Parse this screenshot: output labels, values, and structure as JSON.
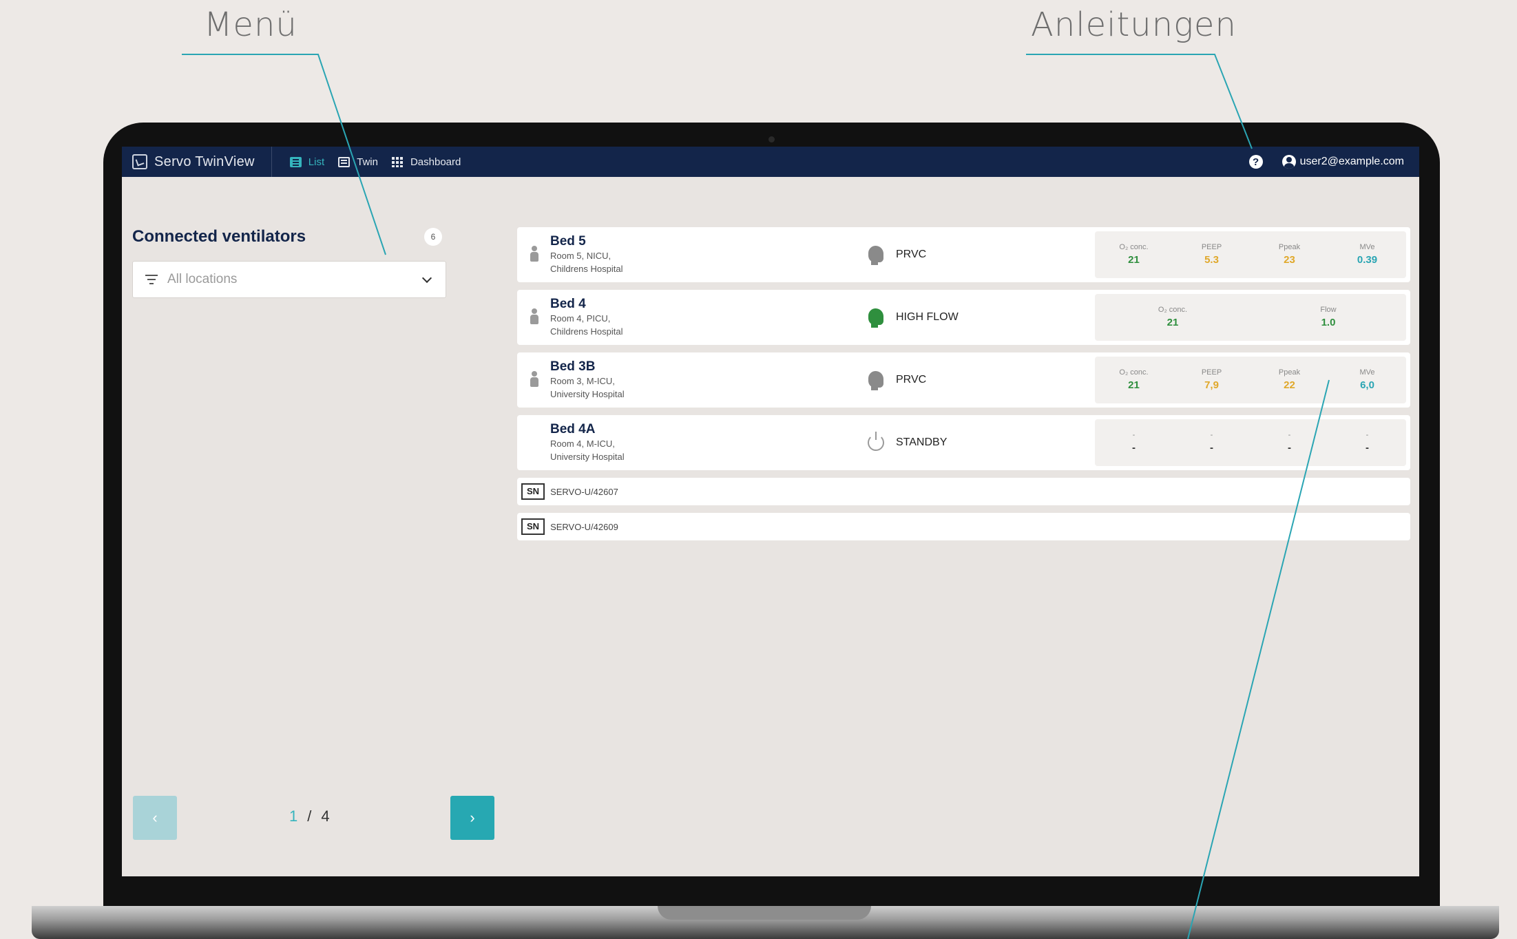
{
  "annotations": {
    "menu_label": "Menü",
    "guides_label": "Anleitungen"
  },
  "app": {
    "brand": "Servo TwinView",
    "nav": [
      {
        "label": "List",
        "active": true,
        "icon": "list-icon"
      },
      {
        "label": "Twin",
        "active": false,
        "icon": "twin-icon"
      },
      {
        "label": "Dashboard",
        "active": false,
        "icon": "dashboard-grid-icon"
      }
    ],
    "help_icon": "?",
    "user_email": "user2@example.com"
  },
  "sidebar": {
    "title": "Connected ventilators",
    "count": "6",
    "location_select": "All locations"
  },
  "pager": {
    "prev": "‹",
    "next": "›",
    "current": "1",
    "separator": "/",
    "total": "4"
  },
  "beds": [
    {
      "name": "Bed 5",
      "location_line1": "Room 5, NICU,",
      "location_line2": "Childrens Hospital",
      "mode": "PRVC",
      "mode_icon": "head-icon-gray",
      "params": [
        {
          "label": "O₂ conc.",
          "value": "21",
          "color": "green"
        },
        {
          "label": "PEEP",
          "value": "5.3",
          "color": "amber"
        },
        {
          "label": "Ppeak",
          "value": "23",
          "color": "amber"
        },
        {
          "label": "MVe",
          "value": "0.39",
          "color": "teal"
        }
      ]
    },
    {
      "name": "Bed 4",
      "location_line1": "Room 4, PICU,",
      "location_line2": "Childrens Hospital",
      "mode": "HIGH FLOW",
      "mode_icon": "head-icon-green",
      "params": [
        {
          "label": "O₂ conc.",
          "value": "21",
          "color": "green"
        },
        {
          "label": "Flow",
          "value": "1.0",
          "color": "green"
        }
      ]
    },
    {
      "name": "Bed 3B",
      "location_line1": "Room 3, M-ICU,",
      "location_line2": "University Hospital",
      "mode": "PRVC",
      "mode_icon": "head-icon-gray",
      "params": [
        {
          "label": "O₂ conc.",
          "value": "21",
          "color": "green"
        },
        {
          "label": "PEEP",
          "value": "7,9",
          "color": "amber"
        },
        {
          "label": "Ppeak",
          "value": "22",
          "color": "amber"
        },
        {
          "label": "MVe",
          "value": "6,0",
          "color": "teal"
        }
      ]
    },
    {
      "name": "Bed 4A",
      "location_line1": "Room 4, M-ICU,",
      "location_line2": "University Hospital",
      "mode": "STANDBY",
      "mode_icon": "power-icon",
      "params": [
        {
          "label": "-",
          "value": "-",
          "color": "dark"
        },
        {
          "label": "-",
          "value": "-",
          "color": "dark"
        },
        {
          "label": "-",
          "value": "-",
          "color": "dark"
        },
        {
          "label": "-",
          "value": "-",
          "color": "dark"
        }
      ]
    }
  ],
  "serials": [
    {
      "badge": "SN",
      "serial": "SERVO-U/42607"
    },
    {
      "badge": "SN",
      "serial": "SERVO-U/42609"
    }
  ],
  "colors": {
    "navy": "#13254a",
    "teal": "#35b4bd",
    "green": "#2f8f3e",
    "amber": "#e0a82a"
  }
}
